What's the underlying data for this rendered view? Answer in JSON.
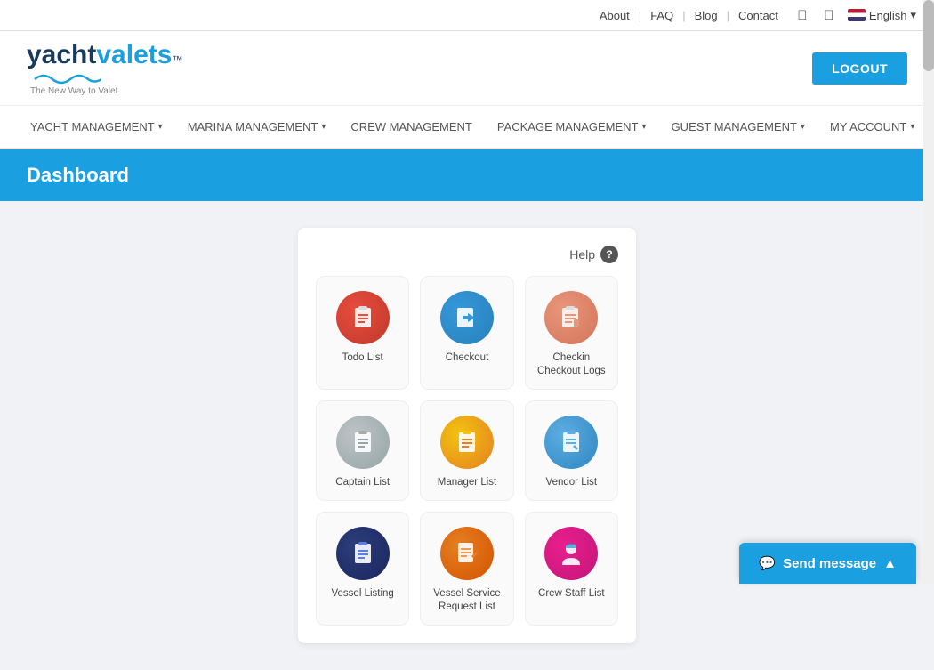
{
  "topbar": {
    "links": [
      "About",
      "FAQ",
      "Blog",
      "Contact"
    ],
    "language": "English",
    "social": [
      "facebook",
      "twitter"
    ]
  },
  "header": {
    "logo_yacht": "yacht",
    "logo_valets": "valets",
    "logo_tm": "™",
    "logo_tagline": "The New Way to Valet",
    "logout_label": "LOGOUT"
  },
  "nav": {
    "items": [
      {
        "label": "YACHT MANAGEMENT",
        "has_dropdown": true
      },
      {
        "label": "MARINA MANAGEMENT",
        "has_dropdown": true
      },
      {
        "label": "CREW MANAGEMENT",
        "has_dropdown": false
      },
      {
        "label": "PACKAGE MANAGEMENT",
        "has_dropdown": true
      },
      {
        "label": "GUEST MANAGEMENT",
        "has_dropdown": true
      },
      {
        "label": "MY ACCOUNT",
        "has_dropdown": true
      }
    ]
  },
  "dashboard": {
    "title": "Dashboard",
    "help_label": "Help",
    "grid_items": [
      {
        "label": "Todo List",
        "icon": "📋",
        "color_class": "icon-red"
      },
      {
        "label": "Checkout",
        "icon": "↪",
        "color_class": "icon-blue"
      },
      {
        "label": "Checkin Checkout Logs",
        "icon": "📋",
        "color_class": "icon-salmon"
      },
      {
        "label": "Captain List",
        "icon": "📋",
        "color_class": "icon-gray"
      },
      {
        "label": "Manager List",
        "icon": "📋",
        "color_class": "icon-yellow"
      },
      {
        "label": "Vendor List",
        "icon": "📋",
        "color_class": "icon-teal"
      },
      {
        "label": "Vessel Listing",
        "icon": "📋",
        "color_class": "icon-navy"
      },
      {
        "label": "Vessel Service Request List",
        "icon": "📄",
        "color_class": "icon-orange"
      },
      {
        "label": "Crew Staff List",
        "icon": "👤",
        "color_class": "icon-pink"
      }
    ],
    "send_message_label": "Send message"
  }
}
